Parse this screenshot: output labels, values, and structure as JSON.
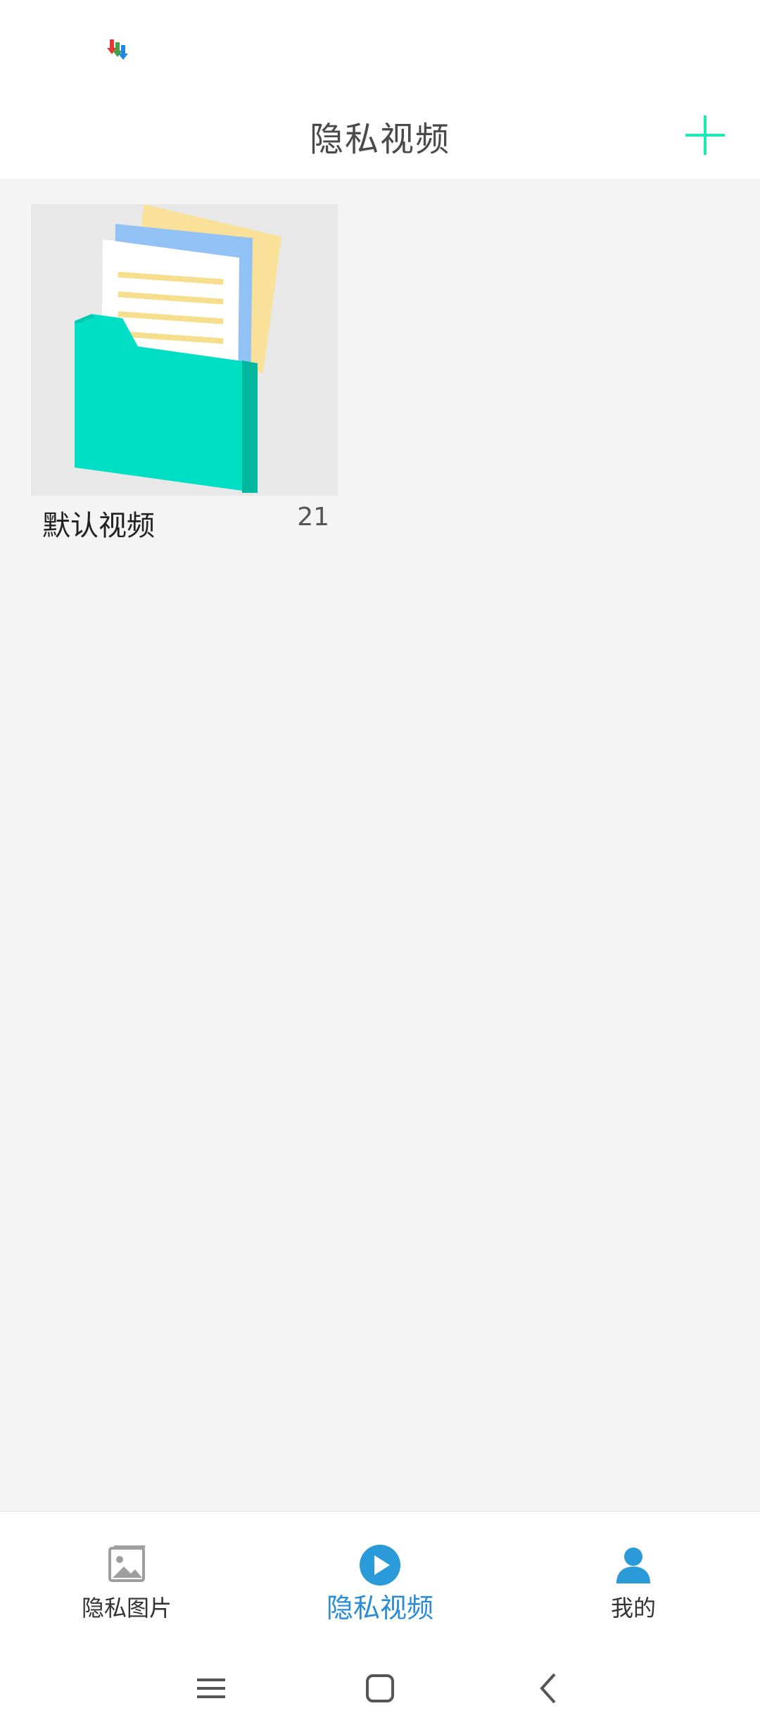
{
  "status_bar": {
    "app_icon": "download-arrows-icon"
  },
  "header": {
    "title": "隐私视频",
    "add_icon": "plus-icon",
    "accent": "#1de9b6"
  },
  "albums": [
    {
      "name": "默认视频",
      "count": "21",
      "cover_icon": "folder-with-documents-icon"
    }
  ],
  "bottom_nav": {
    "items": [
      {
        "label": "隐私图片",
        "icon": "image-icon",
        "active": false
      },
      {
        "label": "隐私视频",
        "icon": "play-circle-icon",
        "active": true
      },
      {
        "label": "我的",
        "icon": "user-icon",
        "active": false
      }
    ],
    "active_color": "#2a8bd6"
  },
  "system_nav": {
    "buttons": [
      "menu-icon",
      "home-icon",
      "back-icon"
    ]
  }
}
